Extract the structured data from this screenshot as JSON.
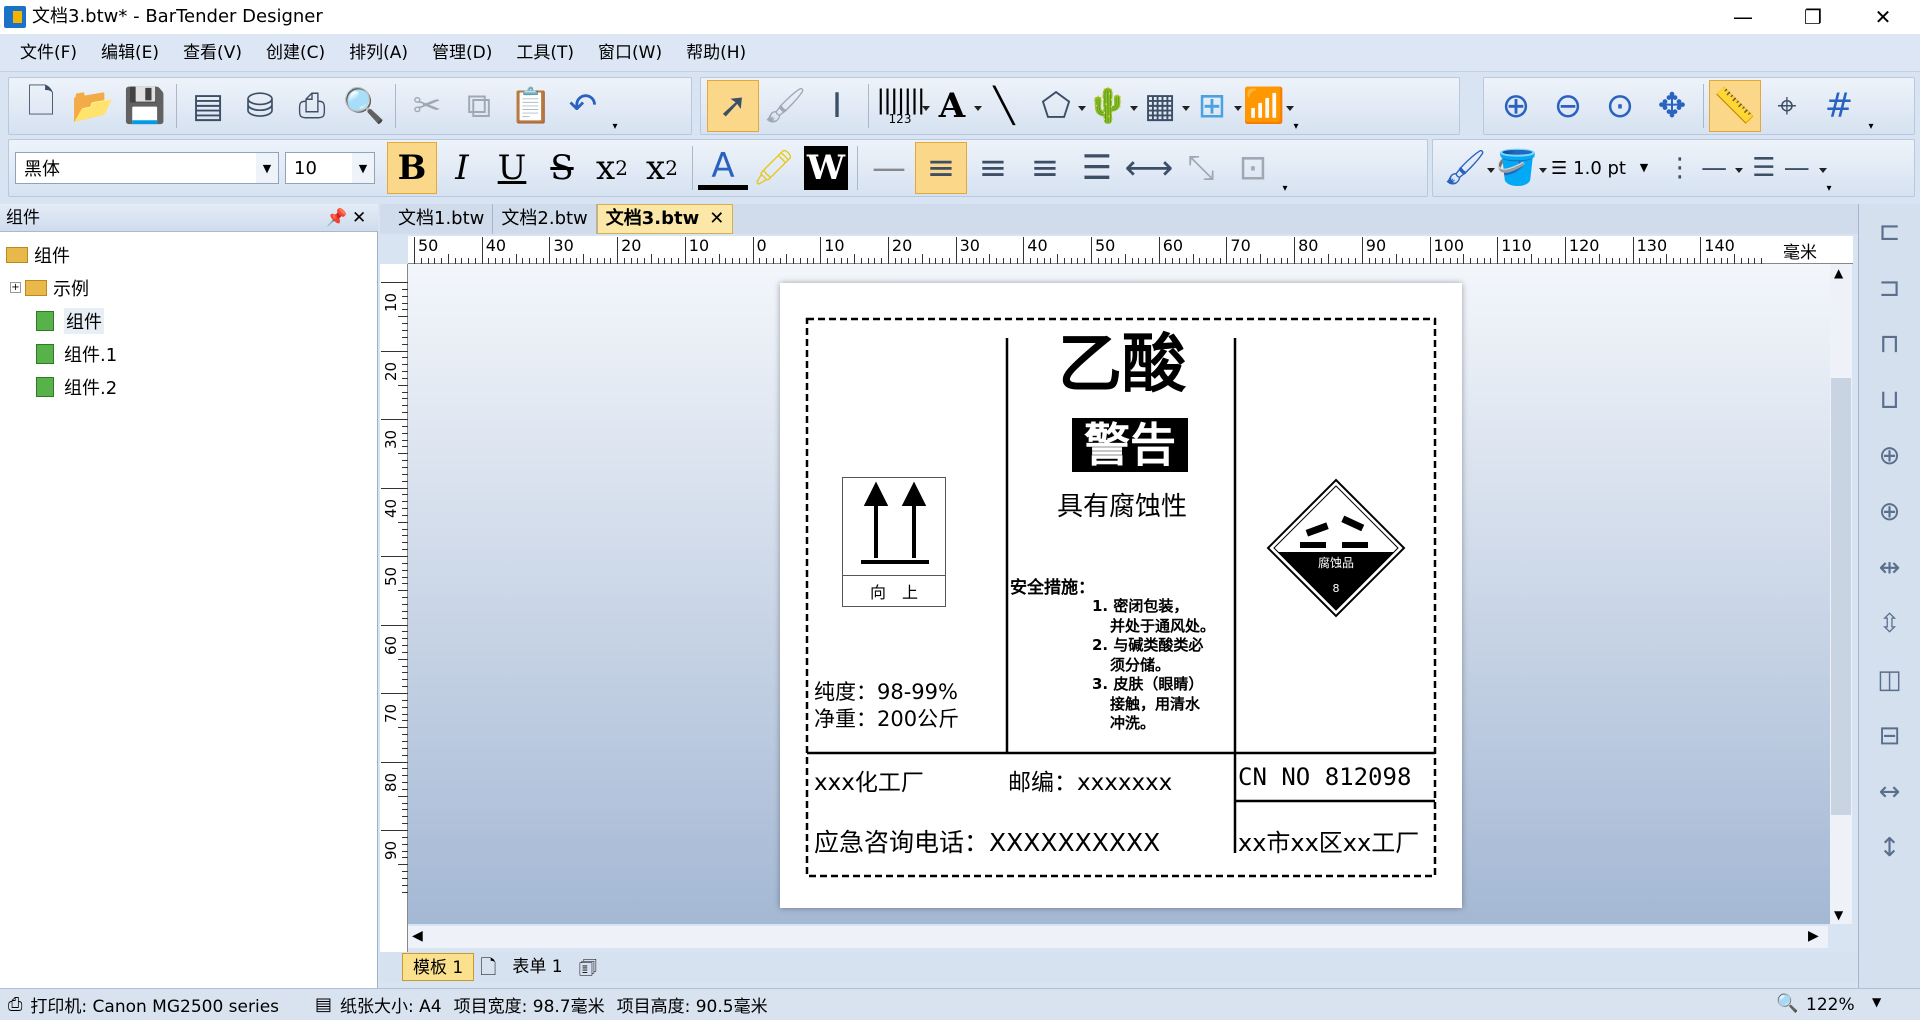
{
  "window": {
    "title": "文档3.btw* - BarTender Designer",
    "min": "—",
    "max": "❐",
    "close": "✕"
  },
  "menu": [
    "文件(F)",
    "编辑(E)",
    "查看(V)",
    "创建(C)",
    "排列(A)",
    "管理(D)",
    "工具(T)",
    "窗口(W)",
    "帮助(H)"
  ],
  "toolbar": {
    "font_name": "黑体",
    "font_size": "10",
    "bold": "B",
    "italic": "I",
    "underline": "U",
    "strike": "S",
    "subscript_base": "x",
    "subscript_mark": "2",
    "superscript_base": "x",
    "superscript_mark": "2",
    "text_color_glyph": "A",
    "word_art": "W",
    "barcode_digits": "123",
    "text_tool": "A",
    "line_weight": "1.0 pt"
  },
  "panel": {
    "title": "组件",
    "pin": "📌",
    "close": "✕",
    "tree": {
      "root": "组件",
      "examples": "示例",
      "item1": "组件",
      "item2": "组件.1",
      "item3": "组件.2"
    }
  },
  "tabs": [
    {
      "label": "文档1.btw"
    },
    {
      "label": "文档2.btw"
    },
    {
      "label": "文档3.btw"
    }
  ],
  "tab_close": "✕",
  "ruler": {
    "unit": "毫米",
    "h_ticks": [
      "50",
      "40",
      "30",
      "20",
      "10",
      "0",
      "10",
      "20",
      "30",
      "40",
      "50",
      "60",
      "70",
      "80",
      "90",
      "100",
      "110",
      "120",
      "130",
      "140"
    ],
    "v_ticks": [
      "10",
      "20",
      "30",
      "40",
      "50",
      "60",
      "70",
      "80",
      "90"
    ]
  },
  "label": {
    "arrow_caption": "向　上",
    "purity": "纯度：98-99%",
    "net_weight": "净重：200公斤",
    "chemical_name": "乙酸",
    "warning": "警告",
    "hazard": "具有腐蚀性",
    "safety_title": "安全措施：",
    "safety_lines": [
      "1. 密闭包装，",
      "并处于通风处。",
      "2. 与碱类酸类必",
      "须分储。",
      "3. 皮肤（眼睛）",
      "接触，用清水",
      "冲洗。"
    ],
    "diamond_text": "腐蚀品",
    "diamond_class": "8",
    "factory": "xxx化工厂",
    "postcode": "邮编：xxxxxxx",
    "cn_no": "CN NO 812098",
    "emergency_phone": "应急咨询电话：XXXXXXXXXX",
    "address": "xx市xx区xx工厂"
  },
  "sheet_tabs": [
    "模板 1",
    "表单 1"
  ],
  "status": {
    "printer": "打印机: Canon MG2500 series",
    "paper": "纸张大小: A4",
    "item_width": "项目宽度: 98.7毫米",
    "item_height": "项目高度: 90.5毫米",
    "zoom": "122%"
  },
  "colors": {
    "selected_button": "#fbd78a",
    "active_tab": "#fbe8a8",
    "canvas_top": "#f3f6fb",
    "canvas_bottom": "#a4b8d4"
  }
}
